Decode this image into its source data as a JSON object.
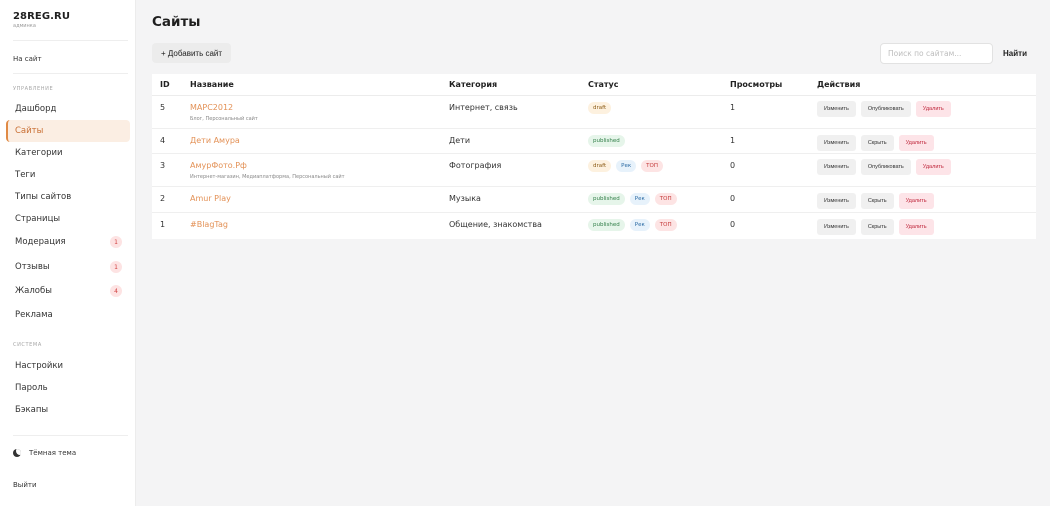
{
  "brand": {
    "title": "28REG.RU",
    "subtitle": "админка"
  },
  "sidebar": {
    "to_site": "На сайт",
    "section_manage": "УПРАВЛЕНИЕ",
    "items": [
      {
        "label": "Дашборд"
      },
      {
        "label": "Сайты",
        "active": true
      },
      {
        "label": "Категории"
      },
      {
        "label": "Теги"
      },
      {
        "label": "Типы сайтов"
      },
      {
        "label": "Страницы"
      },
      {
        "label": "Модерация",
        "badge": "1"
      },
      {
        "label": "Отзывы",
        "badge": "1"
      },
      {
        "label": "Жалобы",
        "badge": "4"
      },
      {
        "label": "Реклама"
      }
    ],
    "section_system": "СИСТЕМА",
    "system_items": [
      {
        "label": "Настройки"
      },
      {
        "label": "Пароль"
      },
      {
        "label": "Бэкапы"
      }
    ],
    "theme_toggle": "Тёмная тема",
    "logout": "Выйти"
  },
  "main": {
    "title": "Сайты",
    "add_button": "+ Добавить сайт",
    "search_placeholder": "Поиск по сайтам...",
    "search_button": "Найти"
  },
  "table": {
    "headers": {
      "id": "ID",
      "name": "Название",
      "category": "Категория",
      "status": "Статус",
      "views": "Просмотры",
      "actions": "Действия"
    },
    "rows": [
      {
        "id": "5",
        "name": "МАРС2012",
        "sub": "Блог, Персональный сайт",
        "category": "Интернет, связь",
        "status": "draft",
        "rek": "",
        "top": "",
        "views": "1",
        "edit": "Изменить",
        "toggle": "Опубликовать",
        "delete": "Удалить"
      },
      {
        "id": "4",
        "name": "Дети Амура",
        "sub": "",
        "category": "Дети",
        "status": "published",
        "rek": "",
        "top": "",
        "views": "1",
        "edit": "Изменить",
        "toggle": "Скрыть",
        "delete": "Удалить"
      },
      {
        "id": "3",
        "name": "АмурФото.Рф",
        "sub": "Интернет-магазин, Медиаплатформа, Персональный сайт",
        "category": "Фотография",
        "status": "draft",
        "rek": "Рек",
        "top": "ТОП",
        "views": "0",
        "edit": "Изменить",
        "toggle": "Опубликовать",
        "delete": "Удалить"
      },
      {
        "id": "2",
        "name": "Amur Play",
        "sub": "",
        "category": "Музыка",
        "status": "published",
        "rek": "Рек",
        "top": "ТОП",
        "views": "0",
        "edit": "Изменить",
        "toggle": "Скрыть",
        "delete": "Удалить"
      },
      {
        "id": "1",
        "name": "#BlagTag",
        "sub": "",
        "category": "Общение, знакомства",
        "status": "published",
        "rek": "Рек",
        "top": "ТОП",
        "views": "0",
        "edit": "Изменить",
        "toggle": "Скрыть",
        "delete": "Удалить"
      }
    ]
  },
  "colors": {
    "accent": "#e08a45",
    "link": "#e39156",
    "danger": "#c0283d"
  }
}
